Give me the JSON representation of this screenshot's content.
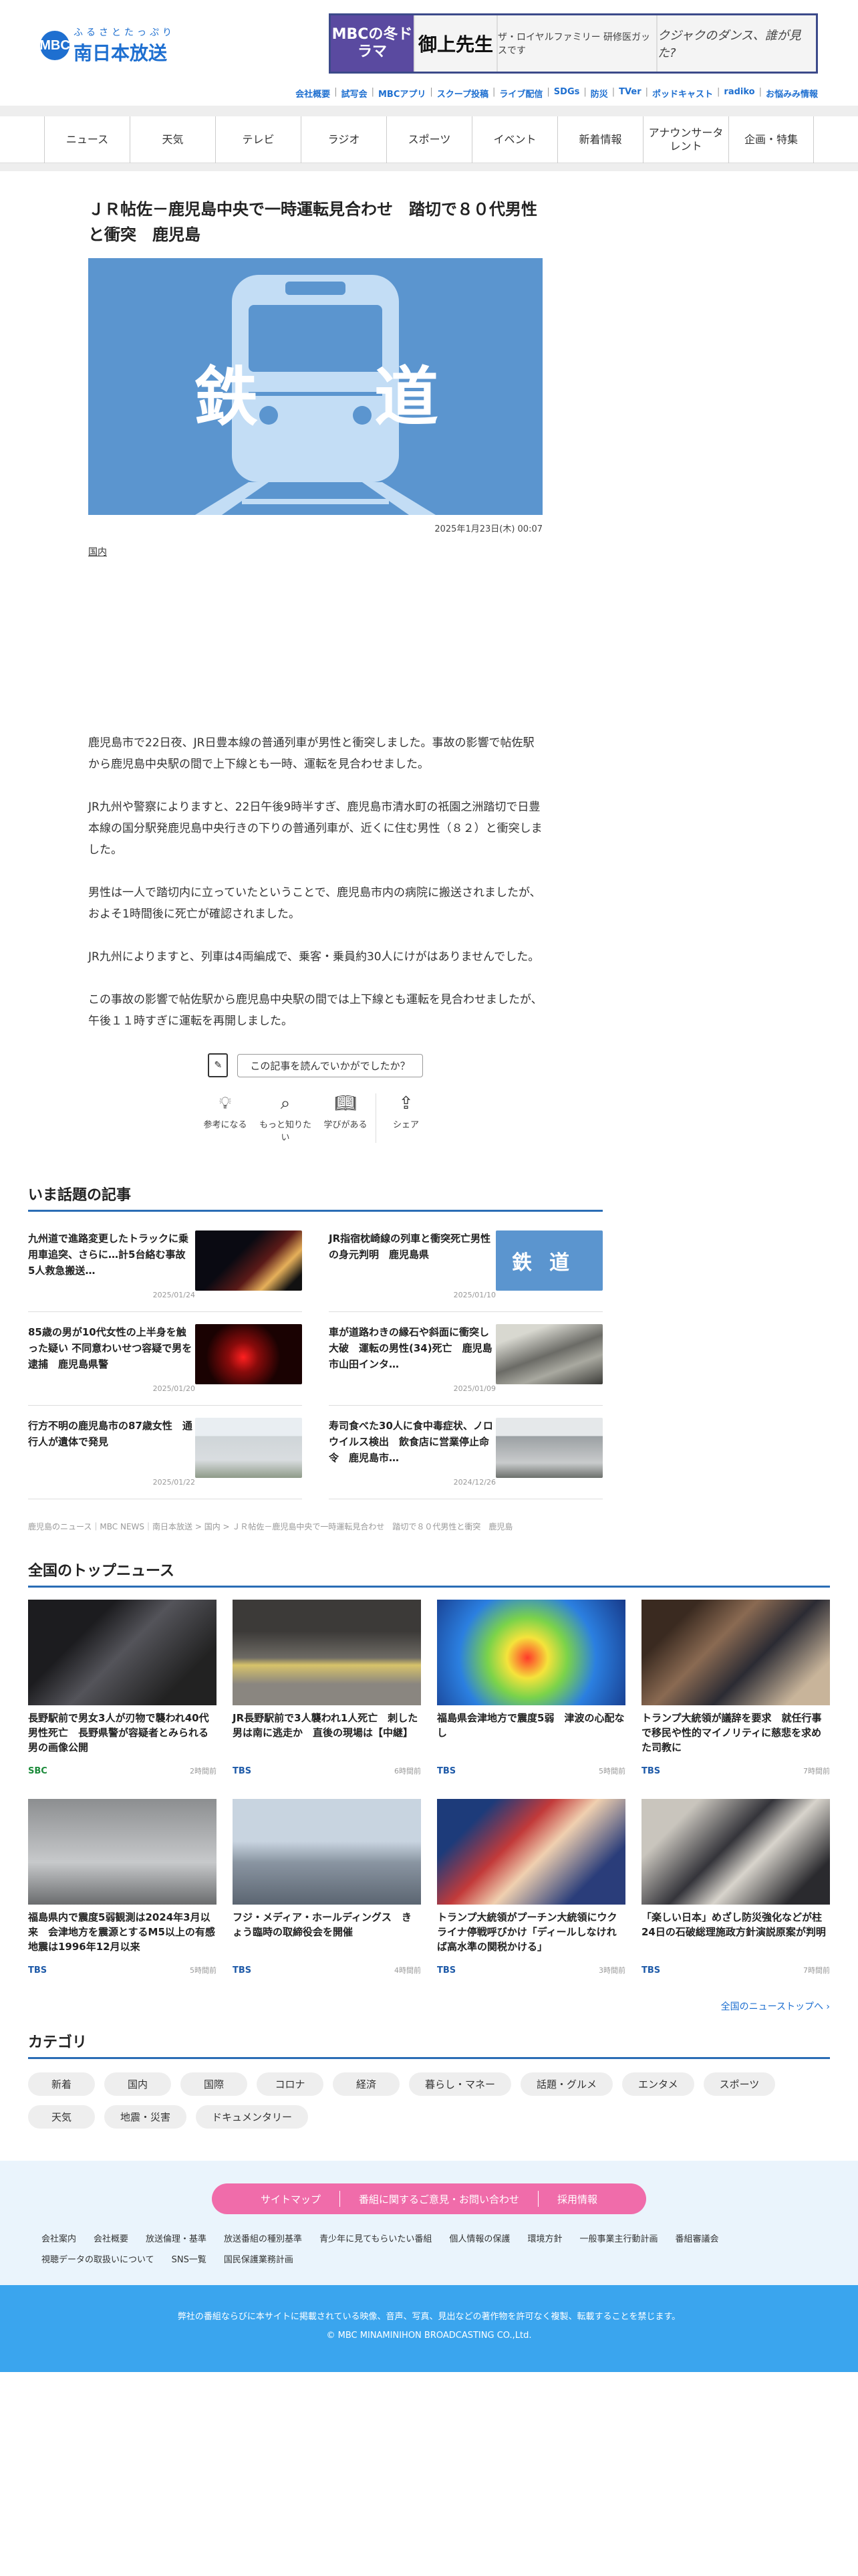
{
  "header": {
    "logo_mark": "MBC",
    "logo_sub": "ふるさとたっぷり",
    "logo_name": "南日本放送",
    "banner": {
      "b1": "MBCの冬ドラマ",
      "b2": "御上先生",
      "b3": "ザ・ロイヤルファミリー 研修医ガッスです",
      "b4": "クジャクのダンス、誰が見た?"
    },
    "top_links": [
      "会社概要",
      "試写会",
      "MBCアプリ",
      "スクープ投稿",
      "ライブ配信",
      "SDGs",
      "防災",
      "TVer",
      "ポッドキャスト",
      "radiko",
      "お悩みみ情報"
    ]
  },
  "nav": [
    "ニュース",
    "天気",
    "テレビ",
    "ラジオ",
    "スポーツ",
    "イベント",
    "新着情報",
    "アナウンサータレント",
    "企画・特集"
  ],
  "article": {
    "title": "ＪＲ帖佐－鹿児島中央で一時運転見合わせ　踏切で８０代男性と衝突　鹿児島",
    "hero_left": "鉄",
    "hero_right": "道",
    "date": "2025年1月23日(木) 00:07",
    "tag": "国内",
    "paragraphs": [
      "鹿児島市で22日夜、JR日豊本線の普通列車が男性と衝突しました。事故の影響で帖佐駅から鹿児島中央駅の間で上下線とも一時、運転を見合わせました。",
      "JR九州や警察によりますと、22日午後9時半すぎ、鹿児島市清水町の祇園之洲踏切で日豊本線の国分駅発鹿児島中央行きの下りの普通列車が、近くに住む男性（８２）と衝突しました。",
      "男性は一人で踏切内に立っていたということで、鹿児島市内の病院に搬送されましたが、およそ1時間後に死亡が確認されました。",
      "JR九州によりますと、列車は4両編成で、乗客・乗員約30人にけがはありませんでした。",
      "この事故の影響で帖佐駅から鹿児島中央駅の間では上下線とも運転を見合わせましたが、午後１１時すぎに運転を再開しました。"
    ],
    "feedback_prompt": "この記事を読んでいかがでしたか？",
    "reactions": [
      "参考になる",
      "もっと知りたい",
      "学びがある",
      "シェア"
    ]
  },
  "trending": {
    "title": "いま話題の記事",
    "items": [
      {
        "title": "九州道で進路変更したトラックに乗用車追突、さらに…計5台絡む事故　5人救急搬送…",
        "date": "2025/01/24"
      },
      {
        "title": "JR指宿枕崎線の列車と衝突死亡男性の身元判明　鹿児島県",
        "date": "2025/01/10"
      },
      {
        "title": "85歳の男が10代女性の上半身を触った疑い 不同意わいせつ容疑で男を逮捕　鹿児島県警",
        "date": "2025/01/20"
      },
      {
        "title": "車が道路わきの縁石や斜面に衝突し大破　運転の男性(34)死亡　鹿児島市山田インタ…",
        "date": "2025/01/09"
      },
      {
        "title": "行方不明の鹿児島市の87歳女性　通行人が遺体で発見",
        "date": "2025/01/22"
      },
      {
        "title": "寿司食べた30人に食中毒症状、ノロウイルス検出　飲食店に営業停止命令　鹿児島市…",
        "date": "2024/12/26"
      }
    ]
  },
  "breadcrumb": "鹿児島のニュース｜MBC NEWS｜南日本放送 > 国内 > ＪＲ帖佐－鹿児島中央で一時運転見合わせ　踏切で８０代男性と衝突　鹿児島",
  "national": {
    "title": "全国のトップニュース",
    "items": [
      {
        "title": "長野駅前で男女3人が刃物で襲われ40代男性死亡　長野県警が容疑者とみられる男の画像公開",
        "src": "SBC",
        "ago": "2時間前"
      },
      {
        "title": "JR長野駅前で3人襲われ1人死亡　刺した男は南に逃走か　直後の現場は【中継】",
        "src": "TBS",
        "ago": "6時間前"
      },
      {
        "title": "福島県会津地方で震度5弱　津波の心配なし",
        "src": "TBS",
        "ago": "5時間前"
      },
      {
        "title": "トランプ大統領が議辞を要求　就任行事で移民や性的マイノリティに慈悲を求めた司教に",
        "src": "TBS",
        "ago": "7時間前"
      },
      {
        "title": "福島県内で震度5弱観測は2024年3月以来　会津地方を震源とするM5以上の有感地震は1996年12月以来",
        "src": "TBS",
        "ago": "5時間前"
      },
      {
        "title": "フジ・メディア・ホールディングス　きょう臨時の取締役会を開催",
        "src": "TBS",
        "ago": "4時間前"
      },
      {
        "title": "トランプ大統領がプーチン大統領にウクライナ停戦呼びかけ「ディールしなければ高水準の関税かける」",
        "src": "TBS",
        "ago": "3時間前"
      },
      {
        "title": "「楽しい日本」めざし防災強化などが柱　24日の石破総理施政方針演説原案が判明",
        "src": "TBS",
        "ago": "7時間前"
      }
    ],
    "more": "全国のニューストップへ ›"
  },
  "categories": {
    "title": "カテゴリ",
    "items": [
      "新着",
      "国内",
      "国際",
      "コロナ",
      "経済",
      "暮らし・マネー",
      "話題・グルメ",
      "エンタメ",
      "スポーツ",
      "天気",
      "地震・災害",
      "ドキュメンタリー"
    ]
  },
  "footer": {
    "pink_links": [
      "サイトマップ",
      "番組に関するご意見・お問い合わせ",
      "採用情報"
    ],
    "links": [
      "会社案内",
      "会社概要",
      "放送倫理・基準",
      "放送番組の種別基準",
      "青少年に見てもらいたい番組",
      "個人情報の保護",
      "環境方針",
      "一般事業主行動計画",
      "番組審議会",
      "視聴データの取扱いについて",
      "SNS一覧",
      "国民保護業務計画"
    ],
    "notice": "弊社の番組ならびに本サイトに掲載されている映像、音声、写真、見出などの著作物を許可なく複製、転載することを禁じます。",
    "copyright": "© MBC MINAMINIHON BROADCASTING CO.,Ltd."
  }
}
